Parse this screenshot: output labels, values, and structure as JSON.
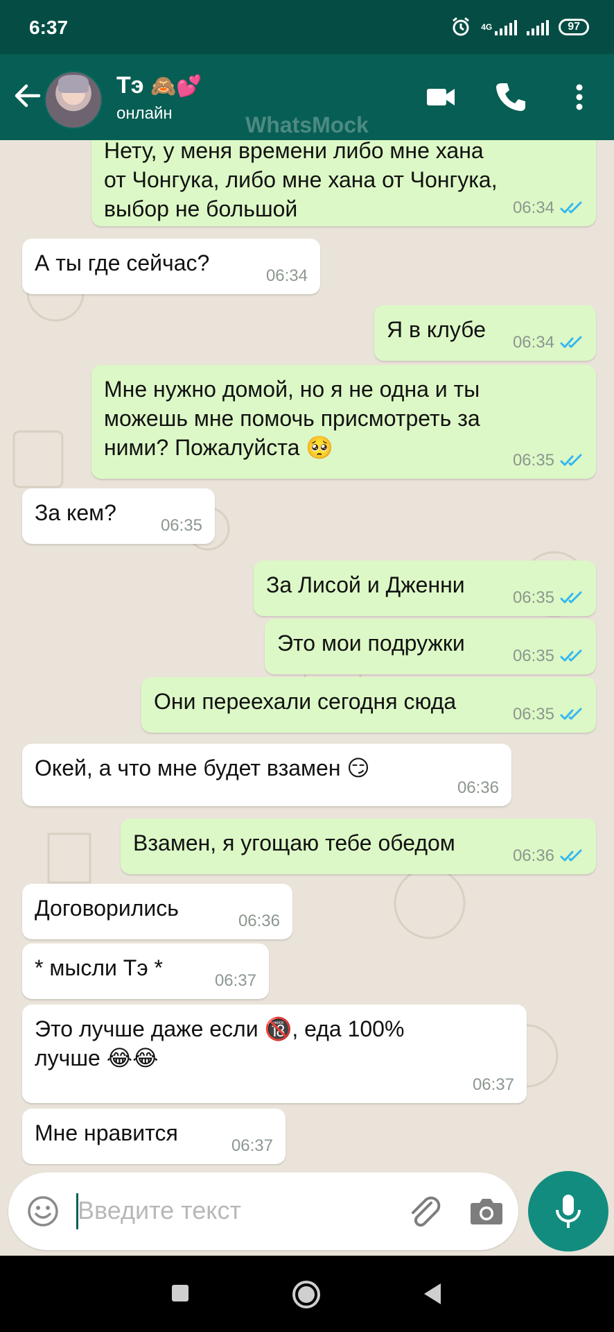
{
  "status_bar": {
    "time": "6:37",
    "network": "4G",
    "battery": "97"
  },
  "header": {
    "contact_name": "Тэ",
    "contact_emoji": "🙈💕",
    "contact_status": "онлайн",
    "watermark": "WhatsMock"
  },
  "messages": [
    {
      "dir": "out",
      "lines": [
        "Нету, у меня времени либо мне хана",
        "от Чонгука, либо мне хана от Чонгука,",
        "выбор не большой"
      ],
      "time": "06:34",
      "read": true
    },
    {
      "dir": "in",
      "lines": [
        "А ты где сейчас?"
      ],
      "time": "06:34"
    },
    {
      "dir": "out",
      "lines": [
        "Я в клубе"
      ],
      "time": "06:34",
      "read": true
    },
    {
      "dir": "out",
      "lines": [
        "Мне нужно домой, но я не одна и ты",
        "можешь мне помочь присмотреть за",
        "ними? Пожалуйста 🥺"
      ],
      "time": "06:35",
      "read": true
    },
    {
      "dir": "in",
      "lines": [
        "За кем?"
      ],
      "time": "06:35"
    },
    {
      "dir": "out",
      "lines": [
        "За Лисой и Дженни"
      ],
      "time": "06:35",
      "read": true
    },
    {
      "dir": "out",
      "lines": [
        "Это мои подружки"
      ],
      "time": "06:35",
      "read": true
    },
    {
      "dir": "out",
      "lines": [
        "Они переехали сегодня сюда"
      ],
      "time": "06:35",
      "read": true
    },
    {
      "dir": "in",
      "lines": [
        "Окей, а что мне будет взамен 😏"
      ],
      "time": "06:36"
    },
    {
      "dir": "out",
      "lines": [
        "Взамен, я угощаю тебе обедом"
      ],
      "time": "06:36",
      "read": true
    },
    {
      "dir": "in",
      "lines": [
        "Договорились"
      ],
      "time": "06:36"
    },
    {
      "dir": "in",
      "lines": [
        "* мысли Тэ *"
      ],
      "time": "06:37"
    },
    {
      "dir": "in",
      "lines": [
        "Это лучше даже если 🔞, еда 100%",
        "лучше 😂😂"
      ],
      "time": "06:37"
    },
    {
      "dir": "in",
      "lines": [
        "Мне нравится"
      ],
      "time": "06:37"
    }
  ],
  "composer": {
    "placeholder": "Введите текст"
  },
  "colors": {
    "header": "#075e54",
    "status": "#054d44",
    "outgoing": "#dcf8c6",
    "incoming": "#ffffff",
    "accent": "#128c7e",
    "tick": "#34b7f1"
  },
  "icons": [
    "back-arrow-icon",
    "video-call-icon",
    "phone-icon",
    "more-vert-icon",
    "emoji-icon",
    "attach-icon",
    "camera-icon",
    "mic-icon",
    "double-check-icon",
    "nav-recents-icon",
    "nav-home-icon",
    "nav-back-icon",
    "alarm-icon",
    "signal-icon",
    "battery-icon"
  ]
}
